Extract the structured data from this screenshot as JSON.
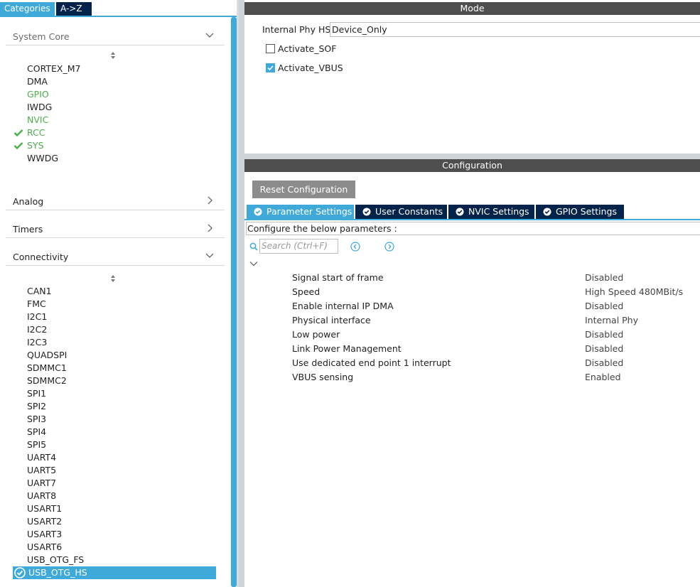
{
  "left_tabs": {
    "categories": "Categories",
    "az": "A->Z"
  },
  "categories": {
    "system_core": {
      "title": "System Core",
      "items": [
        "CORTEX_M7",
        "DMA",
        "GPIO",
        "IWDG",
        "NVIC",
        "RCC",
        "SYS",
        "WWDG"
      ]
    },
    "analog": {
      "title": "Analog"
    },
    "timers": {
      "title": "Timers"
    },
    "connectivity": {
      "title": "Connectivity",
      "items": [
        "CAN1",
        "FMC",
        "I2C1",
        "I2C2",
        "I2C3",
        "QUADSPI",
        "SDMMC1",
        "SDMMC2",
        "SPI1",
        "SPI2",
        "SPI3",
        "SPI4",
        "SPI5",
        "UART4",
        "UART5",
        "UART7",
        "UART8",
        "USART1",
        "USART2",
        "USART3",
        "USART6",
        "USB_OTG_FS"
      ],
      "selected": "USB_OTG_HS"
    }
  },
  "mode": {
    "title": "Mode",
    "phy_label": "Internal Phy HS",
    "phy_value": "Device_Only",
    "activate_sof": {
      "label": "Activate_SOF",
      "checked": false
    },
    "activate_vbus": {
      "label": "Activate_VBUS",
      "checked": true
    }
  },
  "configuration": {
    "title": "Configuration",
    "reset_label": "Reset Configuration",
    "tabs": [
      "Parameter Settings",
      "User Constants",
      "NVIC Settings",
      "GPIO Settings"
    ],
    "description": "Configure the below parameters :",
    "search_placeholder": "Search (Ctrl+F)",
    "params": [
      {
        "name": "Signal start of frame",
        "value": "Disabled"
      },
      {
        "name": "Speed",
        "value": "High Speed 480MBit/s"
      },
      {
        "name": "Enable internal IP DMA",
        "value": "Disabled"
      },
      {
        "name": "Physical interface",
        "value": "Internal Phy"
      },
      {
        "name": "Low power",
        "value": "Disabled"
      },
      {
        "name": "Link Power Management",
        "value": "Disabled"
      },
      {
        "name": "Use dedicated end point 1 interrupt",
        "value": "Disabled"
      },
      {
        "name": "VBUS sensing",
        "value": "Enabled"
      }
    ]
  },
  "colors": {
    "accent": "#3fa9d9",
    "dark_tab": "#03234b",
    "enabled_green": "#4cae4c",
    "header_bar": "#4e4e4e"
  },
  "icons": [
    "check-icon",
    "sort-icon",
    "chevron-down-icon",
    "chevron-right-icon",
    "search-icon",
    "circle-check-icon",
    "arrow-left-circle-icon",
    "arrow-right-circle-icon"
  ]
}
